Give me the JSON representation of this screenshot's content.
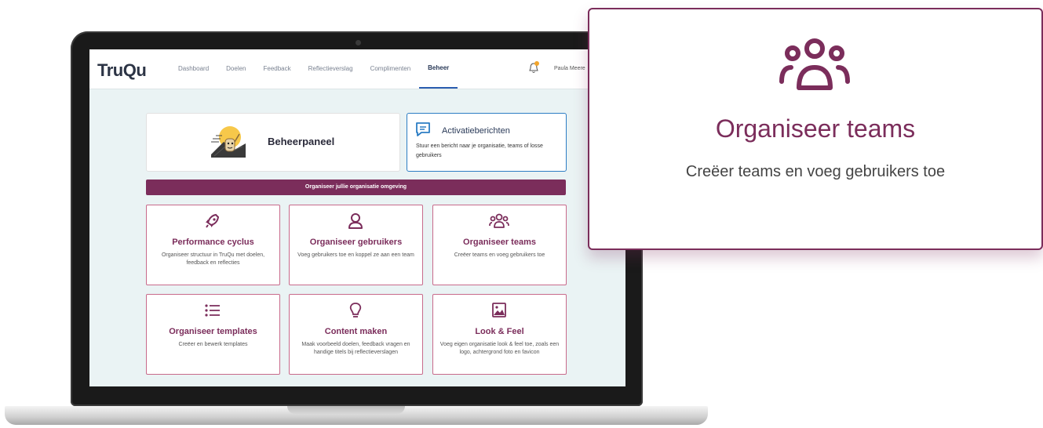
{
  "app": {
    "logo": "TruQu",
    "user_name": "Paula Meere"
  },
  "nav": {
    "items": [
      "Dashboard",
      "Doelen",
      "Feedback",
      "Reflectieverslag",
      "Complimenten",
      "Beheer"
    ],
    "active": "Beheer"
  },
  "hero": {
    "title": "Beheerpaneel"
  },
  "messages": {
    "title": "Activatieberichten",
    "description": "Stuur een bericht naar je organisatie, teams of losse gebruikers"
  },
  "band": {
    "text": "Organiseer jullie organisatie omgeving"
  },
  "cards": [
    {
      "icon": "rocket-icon",
      "title": "Performance cyclus",
      "description": "Organiseer structuur in TruQu met doelen, feedback en reflecties"
    },
    {
      "icon": "user-icon",
      "title": "Organiseer gebruikers",
      "description": "Voeg gebruikers toe en koppel ze aan een team"
    },
    {
      "icon": "users-group-icon",
      "title": "Organiseer teams",
      "description": "Creëer teams en voeg gebruikers toe"
    },
    {
      "icon": "list-icon",
      "title": "Organiseer templates",
      "description": "Creëer en bewerk templates"
    },
    {
      "icon": "lightbulb-icon",
      "title": "Content maken",
      "description": "Maak voorbeeld doelen, feedback vragen en handige titels bij reflectieverslagen"
    },
    {
      "icon": "image-icon",
      "title": "Look & Feel",
      "description": "Voeg eigen organisatie look & feel toe, zoals een logo, achtergrond foto en favicon"
    }
  ],
  "callout": {
    "icon": "users-group-icon",
    "title": "Organiseer teams",
    "description": "Creëer teams en voeg gebruikers toe"
  },
  "colors": {
    "brand": "#7b2d5b",
    "accent": "#2a5db0",
    "notification": "#f2a52b"
  }
}
